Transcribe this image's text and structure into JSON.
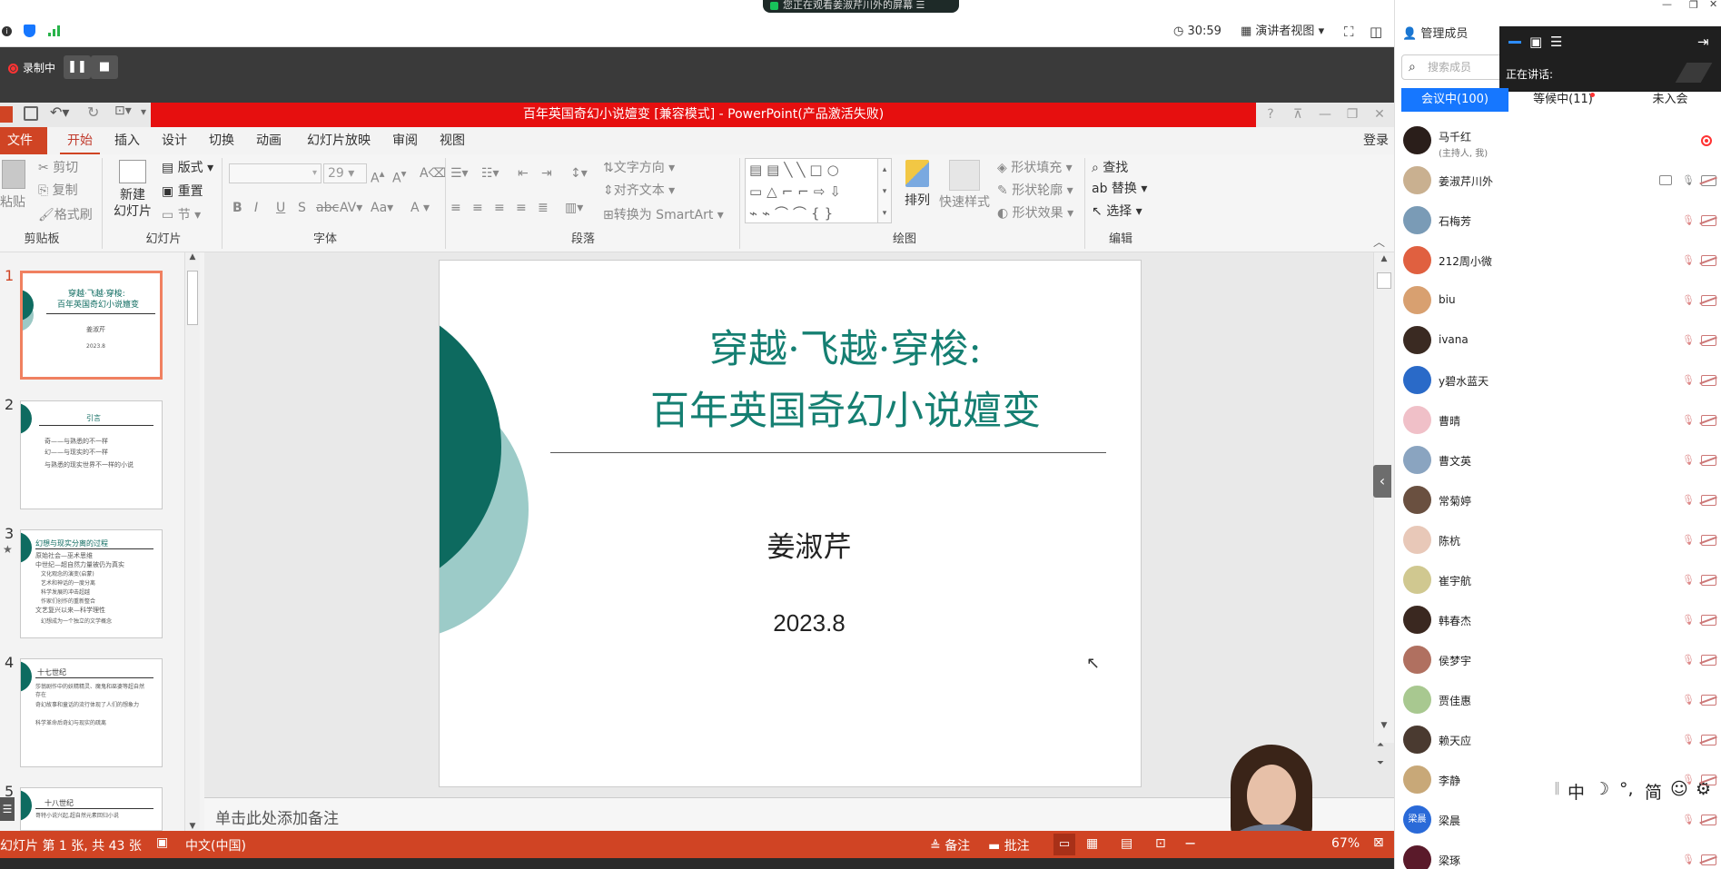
{
  "topbar": {
    "share_banner": "您正在观看姜淑芹川外的屏幕",
    "timer": "30:59",
    "view_mode": "演讲者视图"
  },
  "recording": {
    "label": "录制中"
  },
  "ppt": {
    "title": "百年英国奇幻小说嬗变 [兼容模式] - PowerPoint(产品激活失败)",
    "login": "登录",
    "menus": [
      "文件",
      "开始",
      "插入",
      "设计",
      "切换",
      "动画",
      "幻灯片放映",
      "审阅",
      "视图"
    ],
    "ribbon": {
      "paste": "粘贴",
      "cut": "剪切",
      "copy": "复制",
      "format_painter": "格式刷",
      "new_slide": "新建",
      "new_slide2": "幻灯片",
      "layout": "版式",
      "reset": "重置",
      "section": "节",
      "font_size": "29",
      "text_dir": "文字方向",
      "align_text": "对齐文本",
      "smartart": "转换为 SmartArt",
      "arrange": "排列",
      "quick_styles": "快速样式",
      "shape_fill": "形状填充",
      "shape_outline": "形状轮廓",
      "shape_effect": "形状效果",
      "find": "查找",
      "replace": "替换",
      "select": "选择",
      "groups": {
        "clipboard": "剪贴板",
        "slides": "幻灯片",
        "font": "字体",
        "paragraph": "段落",
        "drawing": "绘图",
        "editing": "编辑"
      }
    },
    "thumbs": [
      {
        "num": "1",
        "title1": "穿越·飞越·穿梭:",
        "title2": "百年英国奇幻小说嬗变",
        "author": "姜淑芹",
        "date": "2023.8"
      },
      {
        "num": "2",
        "title": "引言",
        "b1": "奇——与熟悉的不一样",
        "b2": "幻——与现实的不一样",
        "b3": "与熟悉的现实世界不一样的小说"
      },
      {
        "num": "3",
        "title": "幻想与现实分离的过程",
        "b1": "原始社会—巫术思维",
        "b2": "中世纪—超自然力量被仍为真实",
        "b3": "文化观念的演变(启蒙)",
        "b4": "艺术和神话的一度分离",
        "b5": "科学发展的冲击超越",
        "b6": "作家们创作的重新整合",
        "b7": "文艺复兴以来—科学理性",
        "b8": "幻想成为一个独立的文学概念"
      },
      {
        "num": "4",
        "title": "十七世纪",
        "b1": "莎翁剧作中的妖精精灵、魔鬼和巫婆等超自然存在",
        "b2": "奇幻故事和童话的流行体现了人们的想象力",
        "b3": "科学革命后奇幻与现实的疏离"
      },
      {
        "num": "5",
        "title": "十八世纪",
        "b1": "哥特小说兴起,超自然元素回归小说"
      }
    ],
    "slide": {
      "title1": "穿越·飞越·穿梭:",
      "title2": "百年英国奇幻小说嬗变",
      "author": "姜淑芹",
      "date": "2023.8"
    },
    "notes_placeholder": "单击此处添加备注",
    "status": {
      "slide_info": "幻灯片 第 1 张, 共 43 张",
      "lang": "中文(中国)",
      "notes": "备注",
      "comments": "批注",
      "zoom": "67%"
    }
  },
  "panel": {
    "header": "管理成员",
    "speaking": "正在讲话:",
    "search_placeholder": "搜索成员",
    "tabs": [
      "会议中(100)",
      "等候中(11)",
      "未入会"
    ],
    "members": [
      {
        "name": "马千红",
        "sub": "(主持人, 我)",
        "color": "#2a1e1a"
      },
      {
        "name": "姜淑芹川外",
        "color": "#c9b090"
      },
      {
        "name": "石梅芳",
        "color": "#7a9bb6"
      },
      {
        "name": "212周小微",
        "color": "#e06040"
      },
      {
        "name": "biu",
        "color": "#d8a070"
      },
      {
        "name": "ivana",
        "color": "#3a2a22"
      },
      {
        "name": "y碧水蓝天",
        "color": "#2a6ac8"
      },
      {
        "name": "曹晴",
        "color": "#f0c0c8"
      },
      {
        "name": "曹文英",
        "color": "#8aa4c0"
      },
      {
        "name": "常菊婷",
        "color": "#6a5040"
      },
      {
        "name": "陈杭",
        "color": "#e8c8b8"
      },
      {
        "name": "崔宇航",
        "color": "#d0c890"
      },
      {
        "name": "韩春杰",
        "color": "#3a2820"
      },
      {
        "name": "侯梦宇",
        "color": "#b07060"
      },
      {
        "name": "贾佳惠",
        "color": "#a8c890"
      },
      {
        "name": "赖天应",
        "color": "#4a3a30"
      },
      {
        "name": "李静",
        "color": "#c8a878"
      },
      {
        "name": "梁晨",
        "avatar_text": "梁晨",
        "color": "#2a6ad8"
      },
      {
        "name": "梁琢",
        "color": "#5a1a2a"
      }
    ]
  },
  "ime": {
    "mode": "中",
    "punct": "°,",
    "simp": "简"
  }
}
